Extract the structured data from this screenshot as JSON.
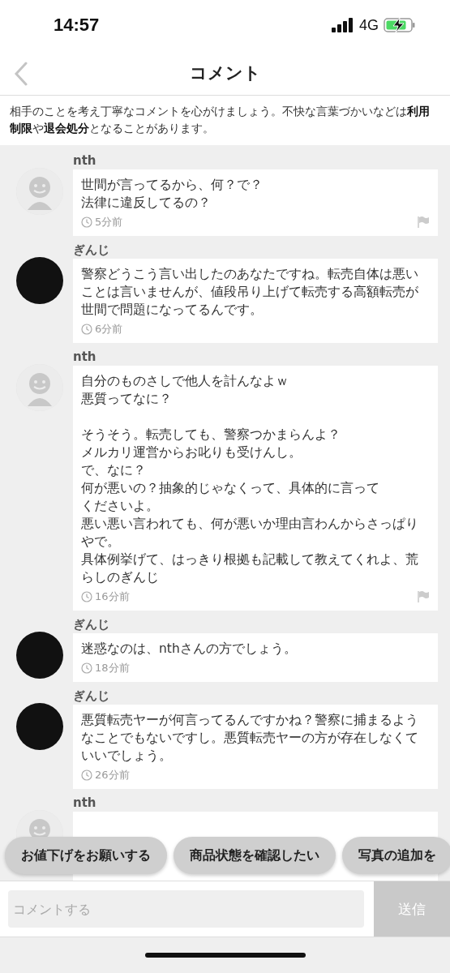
{
  "status_bar": {
    "time": "14:57",
    "network": "4G"
  },
  "header": {
    "title": "コメント"
  },
  "notice": "相手のことを考え丁寧なコメントを心がけましょう。不快な言葉づかいなどは**利用制限**や**退会処分**となることがあります。",
  "comments": [
    {
      "author": "nth",
      "avatar": {
        "kind": "default"
      },
      "paragraphs": [
        [
          "世間が言ってるから、何？で？",
          "法律に違反してるの？"
        ]
      ],
      "time": "5分前",
      "flag": true
    },
    {
      "author": "ぎんじ",
      "avatar": {
        "kind": "photo"
      },
      "paragraphs": [
        [
          "警察どうこう言い出したのあなたですね。転売自体は悪いことは言いませんが、値段吊り上げて転売する高額転売が世間で問題になってるんです。"
        ]
      ],
      "time": "6分前",
      "flag": false
    },
    {
      "author": "nth",
      "avatar": {
        "kind": "default"
      },
      "paragraphs": [
        [
          "自分のものさしで他人を計んなよｗ",
          "悪質ってなに？"
        ],
        [
          "そうそう。転売しても、警察つかまらんよ？",
          "メルカリ運営からお叱りも受けんし。",
          "で、なに？",
          "何が悪いの？抽象的じゃなくって、具体的に言って",
          "くださいよ。",
          "悪い悪い言われても、何が悪いか理由言わんからさっぱりやで。",
          "具体例挙げて、はっきり根拠も記載して教えてくれよ、荒らしのぎんじ"
        ]
      ],
      "time": "16分前",
      "flag": true
    },
    {
      "author": "ぎんじ",
      "avatar": {
        "kind": "photo"
      },
      "paragraphs": [
        [
          "迷惑なのは、nthさんの方でしょう。"
        ]
      ],
      "time": "18分前",
      "flag": false
    },
    {
      "author": "ぎんじ",
      "avatar": {
        "kind": "photo"
      },
      "paragraphs": [
        [
          "悪質転売ヤーが何言ってるんですかね？警察に捕まるようなことでもないですし。悪質転売ヤーの方が存在しなくていいでしょう。"
        ]
      ],
      "time": "26分前",
      "flag": false
    },
    {
      "author": "nth",
      "avatar": {
        "kind": "default"
      }
    }
  ],
  "quick_replies": [
    "お値下げをお願いする",
    "商品状態を確認したい",
    "写真の追加を"
  ],
  "composer": {
    "placeholder": "コメントする",
    "send": "送信"
  }
}
